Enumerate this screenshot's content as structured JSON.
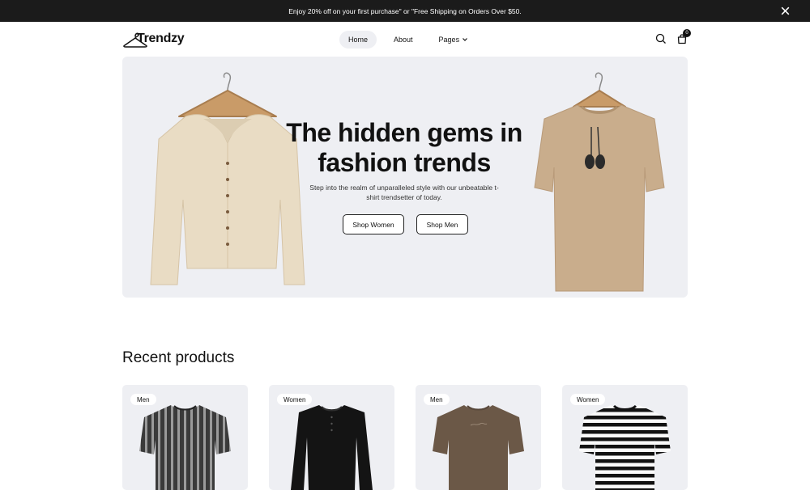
{
  "announcement": {
    "text": "Enjoy 20% off on your first purchase\" or \"Free Shipping on Orders Over $50."
  },
  "header": {
    "logo_text": "Trendzy",
    "nav": [
      {
        "label": "Home"
      },
      {
        "label": "About"
      },
      {
        "label": "Pages"
      }
    ],
    "cart_count": "0"
  },
  "hero": {
    "title": "The hidden gems in fashion trends",
    "subtitle": "Step into the realm of unparalleled style with our unbeatable t-shirt trendsetter of today.",
    "buttons": [
      {
        "label": "Shop Women"
      },
      {
        "label": "Shop Men"
      }
    ]
  },
  "recent": {
    "title": "Recent products",
    "products": [
      {
        "tag": "Men"
      },
      {
        "tag": "Women"
      },
      {
        "tag": "Men"
      },
      {
        "tag": "Women"
      }
    ]
  },
  "colors": {
    "topbar_bg": "#1b1b1b",
    "hero_bg": "#eeeff3",
    "card_bg": "#eeeff3",
    "cardigan": "#e9dcc4",
    "tshirt_beige": "#c9ad8c",
    "tshirt_brown": "#6b5847"
  }
}
